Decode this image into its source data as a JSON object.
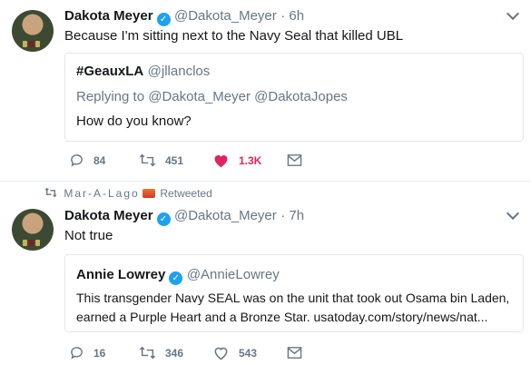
{
  "tweet1": {
    "display_name": "Dakota Meyer",
    "handle": "@Dakota_Meyer",
    "time": "6h",
    "text": "Because I'm sitting next to the Navy Seal that killed UBL",
    "quote": {
      "display_name": "#GeauxLA",
      "handle": "@jllanclos",
      "replying_to": "Replying to @Dakota_Meyer @DakotaJopes",
      "text": "How do you know?"
    },
    "replies": "84",
    "retweets": "451",
    "likes": "1.3K",
    "liked": true
  },
  "retweet_context": {
    "retweeter": "Mar-A-Lago",
    "emoji_icon": "fire-truck-icon",
    "label": "Retweeted"
  },
  "tweet2": {
    "display_name": "Dakota Meyer",
    "handle": "@Dakota_Meyer",
    "time": "7h",
    "text": "Not true",
    "quote": {
      "display_name": "Annie Lowrey",
      "handle": "@AnnieLowrey",
      "text_line1": "This transgender Navy SEAL was on the unit that took out Osama bin Laden,",
      "text_line2": "earned a Purple Heart and a Bronze Star. usatoday.com/story/news/nat..."
    },
    "replies": "16",
    "retweets": "346",
    "likes": "543",
    "liked": false
  },
  "colors": {
    "accent": "#1da1f2",
    "like": "#e0245e",
    "muted": "#657786",
    "border": "#e1e8ed"
  }
}
